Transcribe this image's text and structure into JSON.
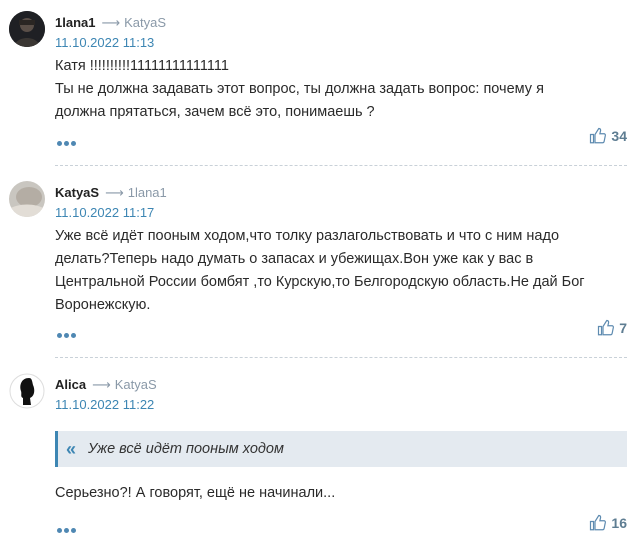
{
  "comments": [
    {
      "author": "1lana1",
      "arrow": "⟶",
      "reply_to": "KatyaS",
      "date": "11.10.2022 11:13",
      "lines": [
        "Катя !!!!!!!!!!11111111111111",
        "Ты не должна задавать этот вопрос, ты должна задать вопрос: почему я",
        "должна прятаться, зачем всё это, понимаешь ?"
      ],
      "likes": "34"
    },
    {
      "author": "KatyaS",
      "arrow": "⟶",
      "reply_to": "1lana1",
      "date": "11.10.2022 11:17",
      "lines": [
        "Уже всё идёт пооным ходом,что толку разлагольствовать и что с ним надо",
        "делать?Теперь надо думать о запасах и убежищах.Вон уже как у вас в",
        "Центральной России бомбят ,то Курскую,то Белгородскую область.Не дай Бог",
        "Воронежскую."
      ],
      "likes": "7"
    },
    {
      "author": "Alica",
      "arrow": "⟶",
      "reply_to": "KatyaS",
      "date": "11.10.2022 11:22",
      "quote": "Уже всё идёт пооным ходом",
      "lines": [
        "Серьезно?! А говорят, ещё не начинали..."
      ],
      "likes": "16"
    }
  ]
}
